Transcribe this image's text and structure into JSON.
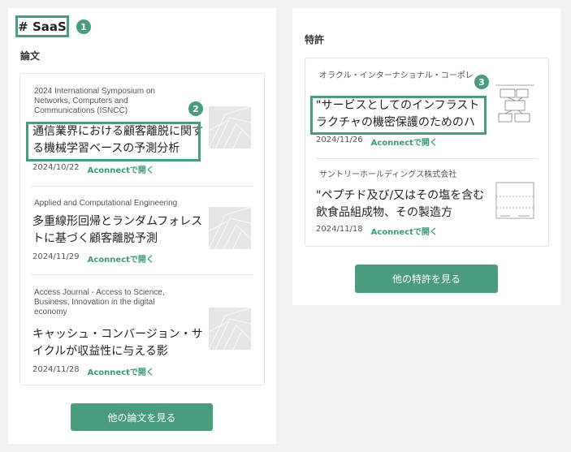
{
  "tag": {
    "label": "# SaaS",
    "badge": "1"
  },
  "papers": {
    "section_title": "論文",
    "items": [
      {
        "source": "2024 International Symposium on Networks, Computers and Communications (ISNCC)",
        "title": "通信業界における顧客離脱に関する機械学習ベースの予測分析",
        "date": "2024/10/22",
        "link": "Aconnectで開く",
        "badge": "2"
      },
      {
        "source": "Applied and Computational Engineering",
        "title": "多重線形回帰とランダムフォレストに基づく顧客離脱予測",
        "date": "2024/11/29",
        "link": "Aconnectで開く"
      },
      {
        "source": "Access Journal - Access to Science, Business, Innovation in the digital economy",
        "title": "キャッシュ・コンバージョン・サイクルが収益性に与える影",
        "date": "2024/11/28",
        "link": "Aconnectで開く"
      }
    ],
    "more_button": "他の論文を見る"
  },
  "patents": {
    "section_title": "特許",
    "items": [
      {
        "source": "オラクル・インターナショナル・コーポレ",
        "title": "\"サービスとしてのインフラストラクチャの機密保護のためのハ",
        "date": "2024/11/26",
        "link": "Aconnectで開く",
        "badge": "3"
      },
      {
        "source": "サントリーホールディングス株式会社",
        "title": "\"ペプチド及び/又はその塩を含む飲食品組成物、その製造方",
        "date": "2024/11/18",
        "link": "Aconnectで開く"
      }
    ],
    "more_button": "他の特許を見る"
  },
  "colors": {
    "accent": "#4a9d7c",
    "link": "#3a9a78"
  }
}
